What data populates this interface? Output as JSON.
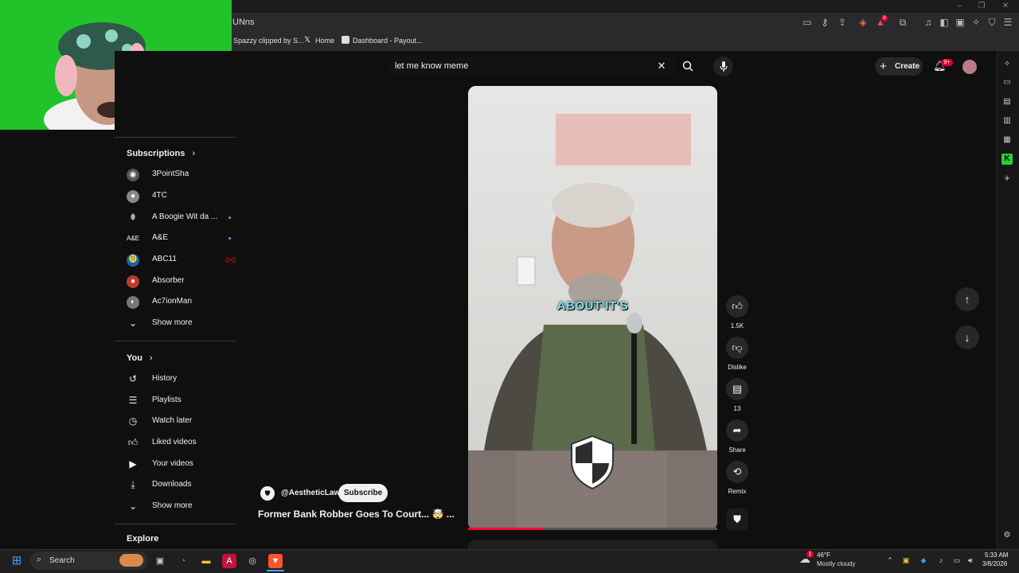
{
  "browser": {
    "address_text": "UNns",
    "bookmarks": [
      "Spazzy clipped by S...",
      "Home",
      "Dashboard - Payout..."
    ],
    "extension_badge": "8"
  },
  "search": {
    "query": "let me know meme",
    "clear_symbol": "✕",
    "search_symbol": "⌕",
    "mic_symbol": "🎤"
  },
  "header": {
    "create_label": "Create",
    "notification_count": "9+"
  },
  "sidebar": {
    "subscriptions_label": "Subscriptions",
    "subscriptions": [
      {
        "name": "3PointSha",
        "new": false
      },
      {
        "name": "4TC",
        "new": false
      },
      {
        "name": "A Boogie Wit da ...",
        "new": true
      },
      {
        "name": "A&E",
        "new": true
      },
      {
        "name": "ABC11",
        "live": true
      },
      {
        "name": "Absorber",
        "new": false
      },
      {
        "name": "Ac7ionMan",
        "new": false
      }
    ],
    "subs_show_more": "Show more",
    "you_label": "You",
    "you_items": [
      "History",
      "Playlists",
      "Watch later",
      "Liked videos",
      "Your videos",
      "Downloads"
    ],
    "you_show_more": "Show more",
    "explore_label": "Explore"
  },
  "short": {
    "caption": "ABOUT IT'S",
    "channel": "@AestheticLaw",
    "subscribe_label": "Subscribe",
    "title": "Former Bank Robber Goes To Court... 🤯 ...",
    "progress": 0.3,
    "actions": {
      "like_count": "1.5K",
      "dislike_label": "Dislike",
      "comment_count": "13",
      "share_label": "Share",
      "remix_label": "Remix"
    }
  },
  "taskbar": {
    "search_placeholder": "Search",
    "weather_temp": "46°F",
    "weather_desc": "Mostly cloudy",
    "time": "5:33 AM",
    "date": "3/8/2026",
    "weather_badge": "1"
  },
  "colors": {
    "background": "#0f0f0f",
    "accent_red": "#ff0033",
    "link_blue": "#3ea6ff",
    "webcam_green": "#22c32a"
  }
}
